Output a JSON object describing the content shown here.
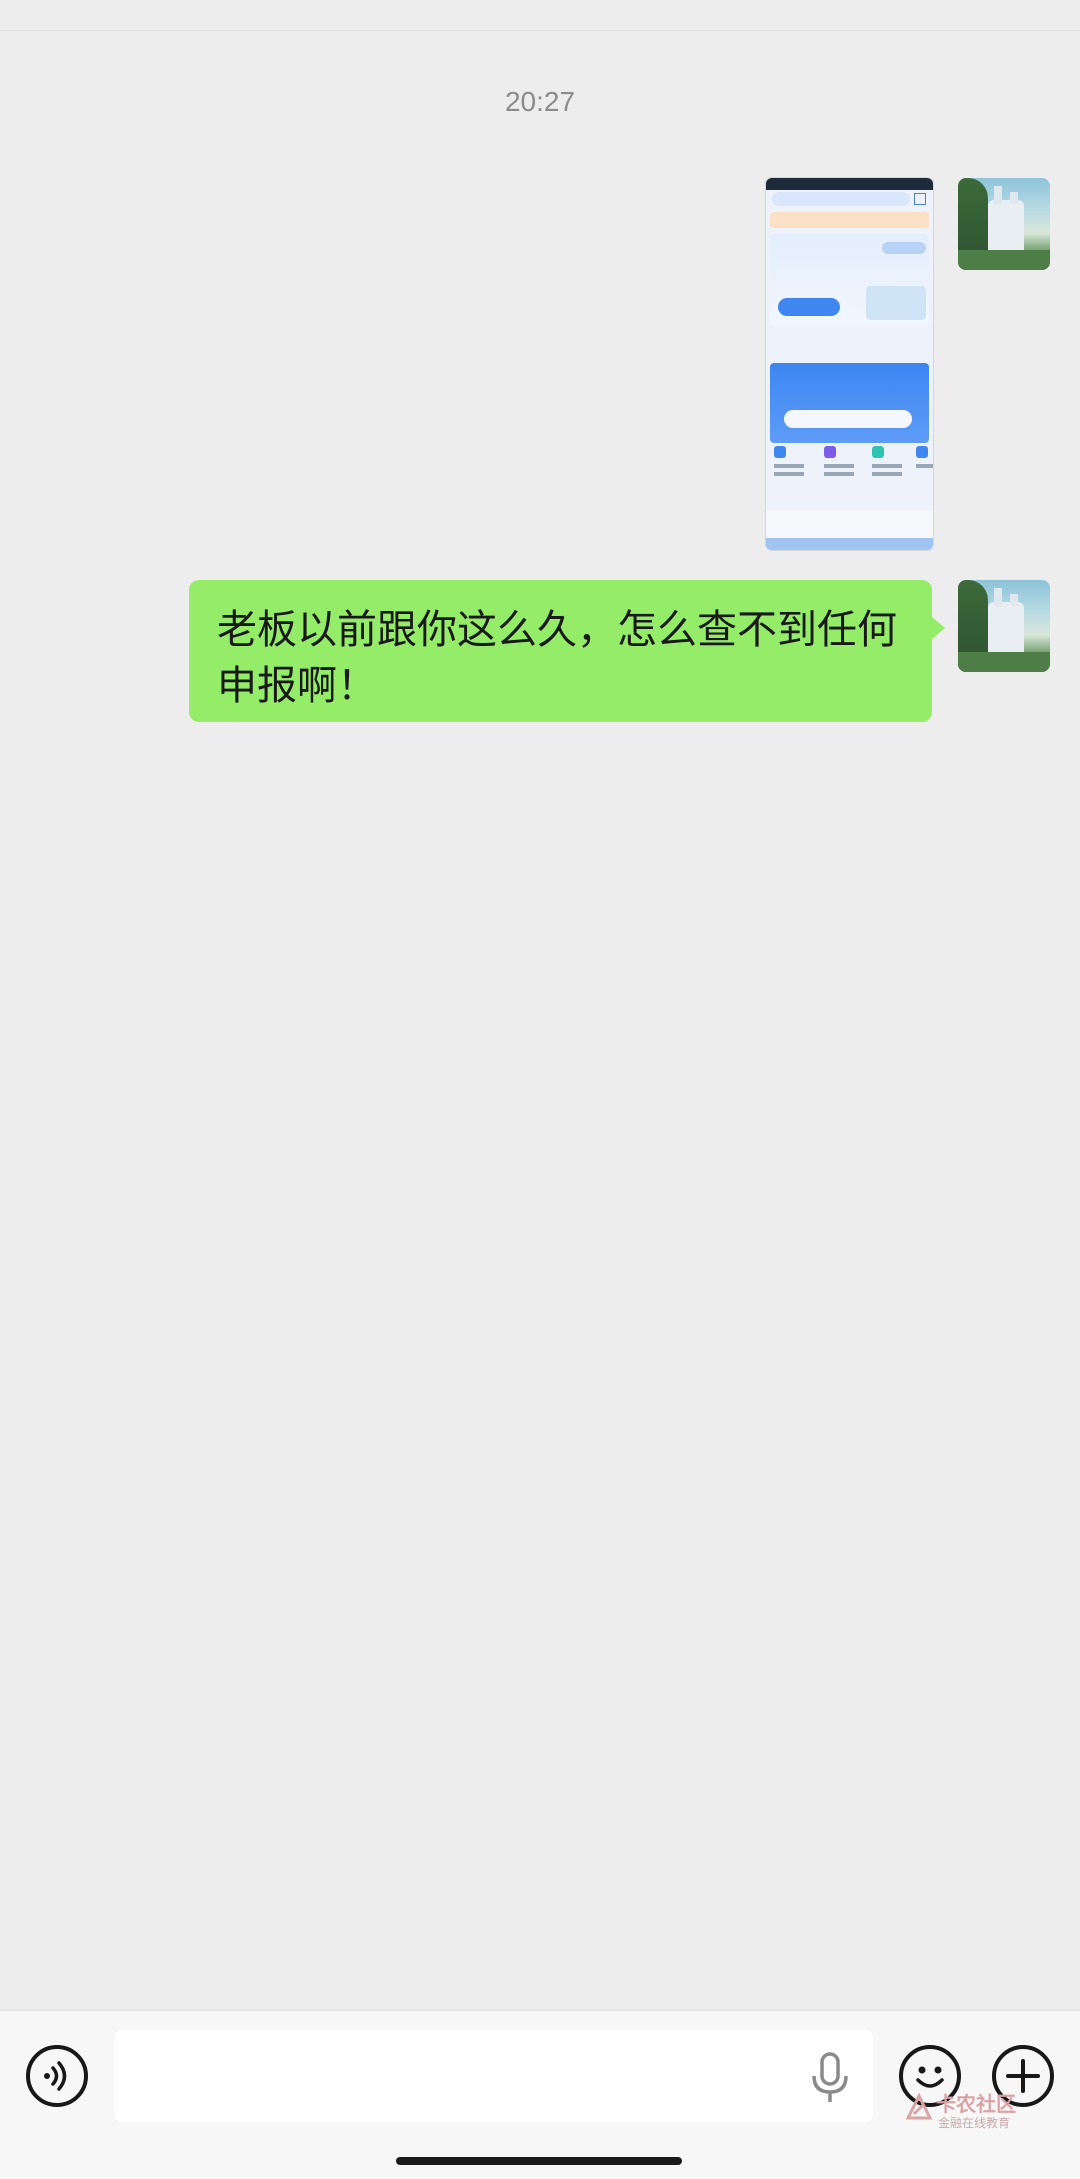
{
  "chat": {
    "timestamp": "20:27",
    "message_text": "老板以前跟你这么久，怎么查不到任何申报啊！",
    "image_message": {
      "icon": "screenshot-thumbnail",
      "accent": "#3f86f0"
    }
  },
  "input_bar": {
    "voice_icon": "voice-icon",
    "mic_icon": "microphone-icon",
    "emoji_icon": "emoji-icon",
    "plus_icon": "plus-icon",
    "placeholder": ""
  },
  "watermark": {
    "title": "卡农社区",
    "subtitle": "金融在线教育"
  },
  "colors": {
    "background": "#ededed",
    "bubble": "#95ec69",
    "timestamp": "#8c8c8c"
  }
}
